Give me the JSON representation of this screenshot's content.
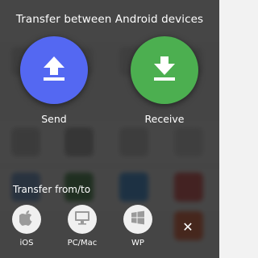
{
  "dialog": {
    "title": "Transfer between Android devices",
    "send": {
      "label": "Send",
      "icon": "upload-icon",
      "color": "#5468f2"
    },
    "receive": {
      "label": "Receive",
      "icon": "download-icon",
      "color": "#4caf50"
    }
  },
  "transfer_from_to": {
    "label": "Transfer from/to",
    "options": [
      {
        "label": "iOS",
        "icon": "apple-icon"
      },
      {
        "label": "PC/Mac",
        "icon": "monitor-icon"
      },
      {
        "label": "WP",
        "icon": "windows-icon"
      }
    ],
    "close_icon": "close-icon",
    "close_glyph": "✕"
  }
}
